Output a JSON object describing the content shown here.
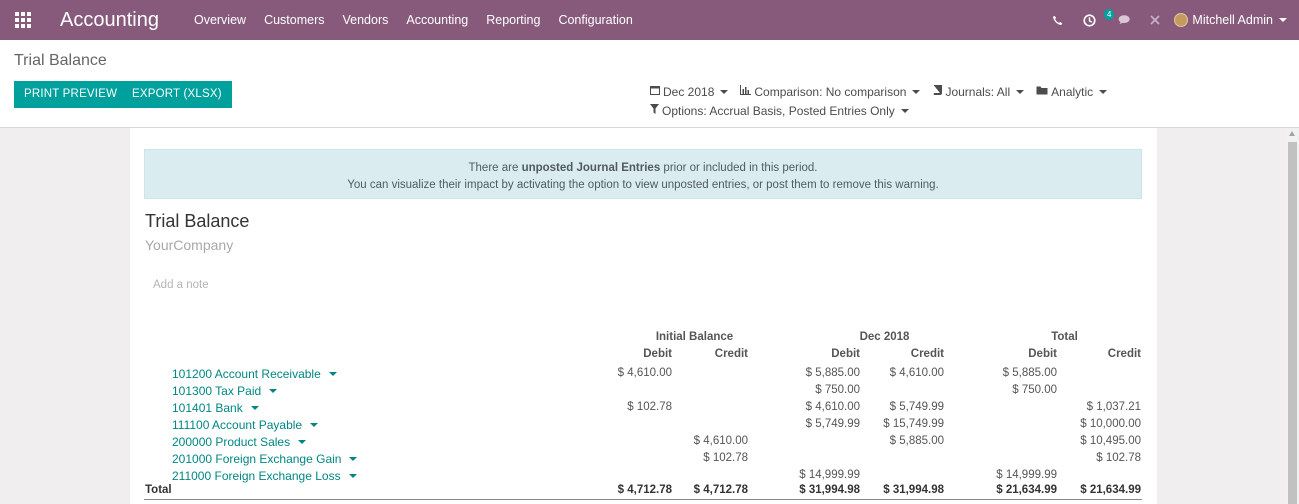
{
  "navbar": {
    "brand": "Accounting",
    "menu": [
      "Overview",
      "Customers",
      "Vendors",
      "Accounting",
      "Reporting",
      "Configuration"
    ],
    "activity_count": "4",
    "user_name": "Mitchell Admin"
  },
  "control_panel": {
    "breadcrumb": "Trial Balance",
    "print_preview_label": "PRINT PREVIEW",
    "export_label": "EXPORT (XLSX)",
    "filters": {
      "date": "Dec 2018",
      "comparison": "Comparison: No comparison",
      "journals": "Journals: All",
      "analytic": "Analytic",
      "options": "Options: Accrual Basis, Posted Entries Only"
    }
  },
  "report": {
    "alert_line1_pre": "There are ",
    "alert_line1_bold": "unposted Journal Entries",
    "alert_line1_post": " prior or included in this period.",
    "alert_line2": "You can visualize their impact by activating the option to view unposted entries, or post them to remove this warning.",
    "title": "Trial Balance",
    "company": "YourCompany",
    "add_note": "Add a note",
    "groups": [
      "Initial Balance",
      "Dec 2018",
      "Total"
    ],
    "subheads": [
      "Debit",
      "Credit",
      "Debit",
      "Credit",
      "Debit",
      "Credit"
    ],
    "rows": [
      {
        "account": "101200 Account Receivable",
        "values": [
          "$ 4,610.00",
          "",
          "$ 5,885.00",
          "$ 4,610.00",
          "$ 5,885.00",
          ""
        ]
      },
      {
        "account": "101300 Tax Paid",
        "values": [
          "",
          "",
          "$ 750.00",
          "",
          "$ 750.00",
          ""
        ]
      },
      {
        "account": "101401 Bank",
        "values": [
          "$ 102.78",
          "",
          "$ 4,610.00",
          "$ 5,749.99",
          "",
          "$ 1,037.21"
        ]
      },
      {
        "account": "111100 Account Payable",
        "values": [
          "",
          "",
          "$ 5,749.99",
          "$ 15,749.99",
          "",
          "$ 10,000.00"
        ]
      },
      {
        "account": "200000 Product Sales",
        "values": [
          "",
          "$ 4,610.00",
          "",
          "$ 5,885.00",
          "",
          "$ 10,495.00"
        ]
      },
      {
        "account": "201000 Foreign Exchange Gain",
        "values": [
          "",
          "$ 102.78",
          "",
          "",
          "",
          "$ 102.78"
        ]
      },
      {
        "account": "211000 Foreign Exchange Loss",
        "values": [
          "",
          "",
          "$ 14,999.99",
          "",
          "$ 14,999.99",
          ""
        ]
      }
    ],
    "total": {
      "label": "Total",
      "values": [
        "$ 4,712.78",
        "$ 4,712.78",
        "$ 31,994.98",
        "$ 31,994.98",
        "$ 21,634.99",
        "$ 21,634.99"
      ]
    }
  }
}
